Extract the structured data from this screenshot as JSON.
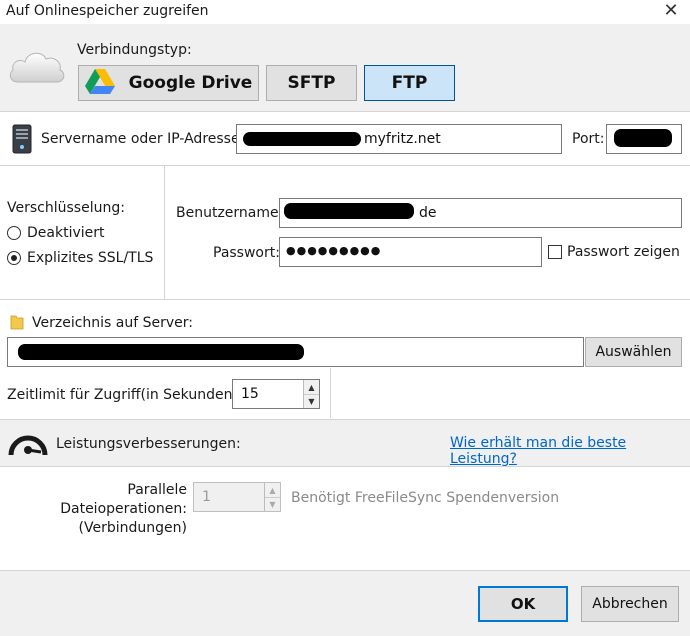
{
  "window": {
    "title": "Auf Onlinespeicher zugreifen"
  },
  "connection": {
    "label": "Verbindungstyp:",
    "google_drive": "Google Drive",
    "sftp": "SFTP",
    "ftp": "FTP",
    "selected": "FTP"
  },
  "server": {
    "label": "Servername oder IP-Adresse:",
    "value_visible": "myfritz.net",
    "port_label": "Port:"
  },
  "encryption": {
    "label": "Verschlüsselung:",
    "options": [
      {
        "label": "Deaktiviert",
        "selected": false
      },
      {
        "label": "Explizites SSL/TLS",
        "selected": true
      }
    ]
  },
  "credentials": {
    "username_label": "Benutzername:",
    "username_visible": "de",
    "password_label": "Passwort:",
    "password_value": "●●●●●●●●●",
    "show_password_label": "Passwort zeigen"
  },
  "directory": {
    "label": "Verzeichnis auf Server:",
    "browse_button": "Auswählen"
  },
  "timeout": {
    "label": "Zeitlimit für Zugriff(in Sekunden):",
    "value": "15"
  },
  "performance": {
    "label": "Leistungsverbesserungen:",
    "help_link": "Wie erhält man die beste Leistung?",
    "parallel_label_line1": "Parallele Dateioperationen:",
    "parallel_label_line2": "(Verbindungen)",
    "parallel_value": "1",
    "donation_note": "Benötigt FreeFileSync Spendenversion"
  },
  "footer": {
    "ok_button": "OK",
    "cancel_button": "Abbrechen"
  },
  "colors": {
    "selected_button": "#cce4f7",
    "link": "#0066cc",
    "band": "#f0f0f0"
  }
}
